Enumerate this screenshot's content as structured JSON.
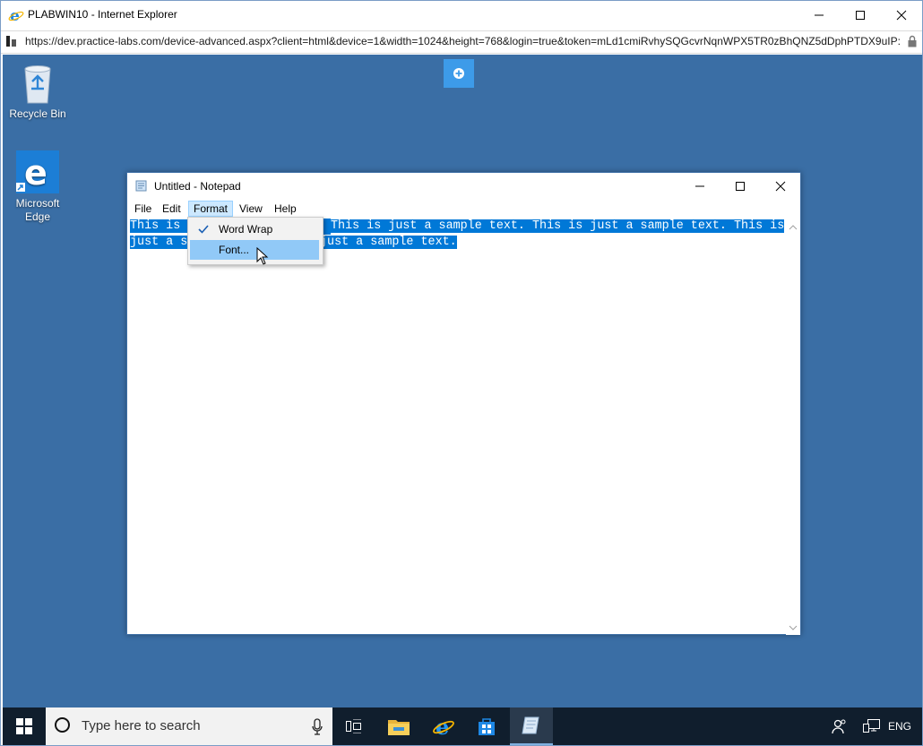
{
  "browser": {
    "title": "PLABWIN10 - Internet Explorer",
    "url": "https://dev.practice-labs.com/device-advanced.aspx?client=html&device=1&width=1024&height=768&login=true&token=mLd1cmiRvhySQGcvrNqnWPX5TR0zBhQNZ5dDphPTDX9uIP:"
  },
  "desktop": {
    "icons": [
      {
        "label_line1": "Recycle Bin",
        "label_line2": ""
      },
      {
        "label_line1": "Microsoft",
        "label_line2": "Edge"
      }
    ],
    "background_color": "#3a6ea5"
  },
  "notepad": {
    "title": "Untitled - Notepad",
    "menu": [
      "File",
      "Edit",
      "Format",
      "View",
      "Help"
    ],
    "active_menu": "Format",
    "text_line1_a": "This is ",
    "text_line1_b": "This is just a sample text. This is just a sample text. This is",
    "text_line2_a": "just a s",
    "text_line2_b": "just a sample text.",
    "selection_color": "#0078d7"
  },
  "format_menu": {
    "items": [
      {
        "label": "Word Wrap",
        "checked": true
      },
      {
        "label": "Font...",
        "checked": false
      }
    ],
    "highlighted": "Font..."
  },
  "taskbar": {
    "search_placeholder": "Type here to search",
    "language": "ENG"
  }
}
